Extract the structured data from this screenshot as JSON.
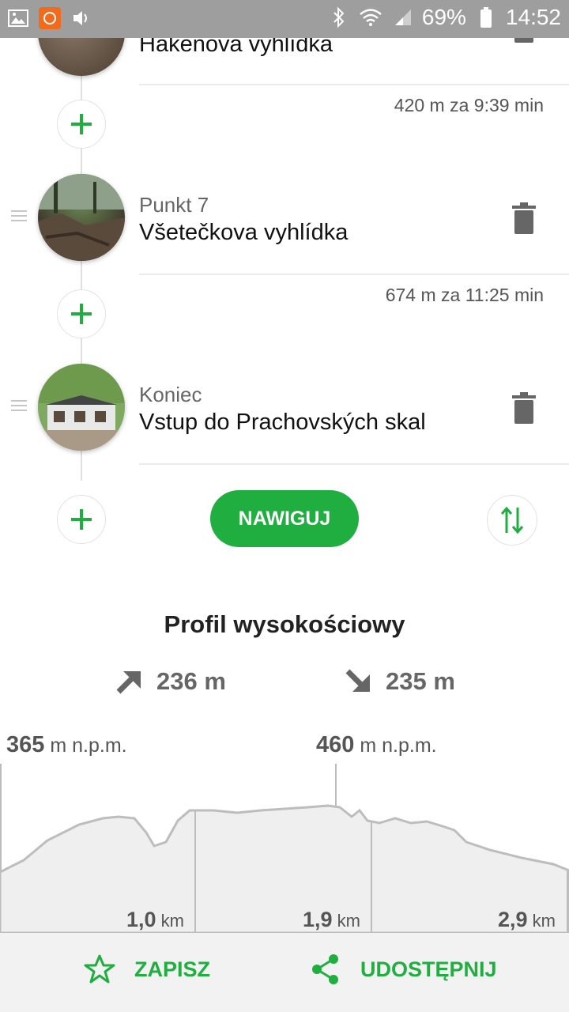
{
  "status_bar": {
    "battery": "69%",
    "time": "14:52",
    "icons": [
      "gallery-icon",
      "app-notification-icon",
      "volume-icon",
      "bluetooth-icon",
      "wifi-icon",
      "signal-icon",
      "battery-icon"
    ]
  },
  "route": {
    "points": [
      {
        "label": "",
        "name": "Hakenova vyhlídka"
      },
      {
        "label": "Punkt 7",
        "name": "Všetečkova vyhlídka"
      },
      {
        "label": "Koniec",
        "name": "Vstup do Prachovských skal"
      }
    ],
    "segments": [
      "420 m za 9:39 min",
      "674 m za 11:25 min"
    ]
  },
  "actions": {
    "navigate_label": "NAWIGUJ"
  },
  "profile": {
    "title": "Profil wysokościowy",
    "ascent": "236 m",
    "descent": "235 m",
    "min_value": "365",
    "max_value": "460",
    "elev_unit": "m n.p.m.",
    "km_marks": [
      {
        "value": "1,0",
        "unit": "km"
      },
      {
        "value": "1,9",
        "unit": "km"
      },
      {
        "value": "2,9",
        "unit": "km"
      }
    ]
  },
  "bottom": {
    "save_label": "ZAPISZ",
    "share_label": "UDOSTĘPNIJ"
  },
  "colors": {
    "accent": "#1fae3f",
    "status_bar": "#9e9e9e",
    "chart_fill": "#efefef",
    "chart_line": "#bdbdbd"
  }
}
